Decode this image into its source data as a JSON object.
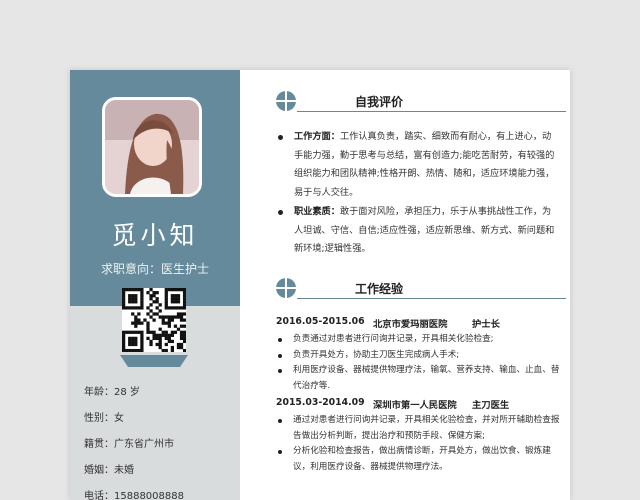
{
  "profile": {
    "name": "觅小知",
    "intent_label": "求职意向：",
    "intent_value": "医生护士"
  },
  "info": [
    {
      "label": "年龄：",
      "value": "28 岁"
    },
    {
      "label": "性别：",
      "value": "女"
    },
    {
      "label": "籍贯：",
      "value": "广东省广州市"
    },
    {
      "label": "婚姻：",
      "value": "未婚"
    },
    {
      "label": "电话：",
      "value": "15888008888"
    }
  ],
  "sections": {
    "self_eval_title": "自我评价",
    "experience_title": "工作经验"
  },
  "self_eval": [
    {
      "label": "工作方面：",
      "text": "工作认真负责，踏实、细致而有耐心，有上进心，动手能力强，勤于思考与总结，富有创造力;能吃苦耐劳，有较强的组织能力和团队精神;性格开朗、热情、随和，适应环境能力强，易于与人交往。"
    },
    {
      "label": "职业素质：",
      "text": "敢于面对风险，承担压力，乐于从事挑战性工作，为人坦诚、守信、自信;适应性强，适应新思维、新方式、新问题和新环境;逻辑性强。"
    }
  ],
  "jobs": [
    {
      "period": "2016.05-2015.06",
      "company": "北京市爱玛丽医院",
      "position": "护士长",
      "items": [
        "负责通过对患者进行问询并记录，开具相关化验检查;",
        "负责开具处方，协助主刀医生完成病人手术;",
        "利用医疗设备、器械提供物理疗法，输氧、营养支持、输血、止血、替代治疗等."
      ]
    },
    {
      "period": "2015.03-2014.09",
      "company": "深圳市第一人民医院",
      "position": "主刀医生",
      "items": [
        "通过对患者进行问询并记录，开具相关化验检查，并对所开辅助检查报告做出分析判断，提出治疗和预防手段、保健方案;",
        "分析化验和检查报告，做出病情诊断，开具处方，做出饮食、锻炼建议，利用医疗设备、器械提供物理疗法。"
      ]
    }
  ],
  "colors": {
    "accent": "#658a9b",
    "left_bg": "#d9dcdd",
    "page_bg": "#e6e6e6"
  },
  "icons": {
    "section_icon": "crosshair-circle-icon",
    "qr": "qr-code",
    "photo": "profile-photo"
  }
}
